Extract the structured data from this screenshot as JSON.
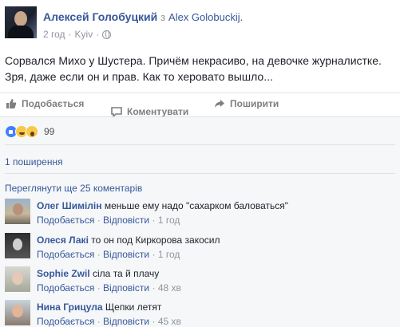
{
  "post": {
    "author": "Алексей Голобуцкий",
    "with_word": "з",
    "target": "Alex Golobuckij.",
    "time": "2 год",
    "dot": "·",
    "location": "Kyiv",
    "text": "Сорвался Михо у Шустера. Причём некрасиво, на девочке журналистке. Зря, даже если он и прав. Как то херовато вышло..."
  },
  "actions": {
    "like": "Подобається",
    "comment": "Коментувати",
    "share": "Поширити"
  },
  "reactions": {
    "count": "99"
  },
  "shares": "1 поширення",
  "more_comments": "Переглянути ще 25 коментарів",
  "comments": [
    {
      "name": "Олег Шимілін",
      "text": "меньше ему надо \"сахарком баловаться\"",
      "like": "Подобається",
      "reply": "Відповісти",
      "sep": "·",
      "time": "1 год"
    },
    {
      "name": "Олеся Лакі",
      "text": "то он под Киркорова закосил",
      "like": "Подобається",
      "reply": "Відповісти",
      "sep": "·",
      "time": "1 год"
    },
    {
      "name": "Sophie Zwil",
      "text": "сіла та й плачу",
      "like": "Подобається",
      "reply": "Відповісти",
      "sep": "·",
      "time": "48 хв"
    },
    {
      "name": "Нина Грицула",
      "text": "Щепки летят",
      "like": "Подобається",
      "reply": "Відповісти",
      "sep": "·",
      "time": "45 хв"
    }
  ]
}
